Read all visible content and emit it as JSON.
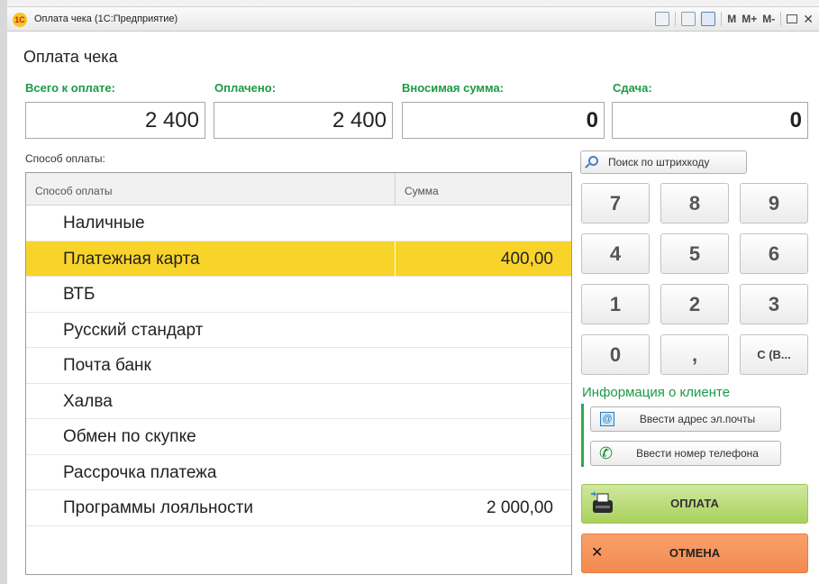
{
  "window": {
    "title": "Оплата чека  (1С:Предприятие)",
    "app_icon_text": "1С",
    "tools": [
      "print-icon",
      "calculator-icon",
      "calendar-icon",
      "M",
      "M+",
      "M-",
      "maximize-icon",
      "close-icon"
    ],
    "tool_labels": {
      "m": "M",
      "m_plus": "M+",
      "m_minus": "M-",
      "close": "✕"
    }
  },
  "page_title": "Оплата чека",
  "totals": {
    "total_label": "Всего к оплате:",
    "total_value": "2 400",
    "paid_label": "Оплачено:",
    "paid_value": "2 400",
    "deposit_label": "Вносимая сумма:",
    "deposit_value": "0",
    "change_label": "Сдача:",
    "change_value": "0"
  },
  "payment_section_label": "Способ оплаты:",
  "payment_table": {
    "columns": [
      "Способ оплаты",
      "Сумма"
    ],
    "rows": [
      {
        "method": "Наличные",
        "amount": ""
      },
      {
        "method": "Платежная карта",
        "amount": "400,00",
        "selected": true
      },
      {
        "method": "ВТБ",
        "amount": ""
      },
      {
        "method": "Русский стандарт",
        "amount": ""
      },
      {
        "method": "Почта банк",
        "amount": ""
      },
      {
        "method": "Халва",
        "amount": ""
      },
      {
        "method": "Обмен по скупке",
        "amount": ""
      },
      {
        "method": "Рассрочка платежа",
        "amount": ""
      },
      {
        "method": "Программы лояльности",
        "amount": "2 000,00"
      }
    ]
  },
  "barcode_search_label": "Поиск по штрихкоду",
  "keypad": [
    "7",
    "8",
    "9",
    "4",
    "5",
    "6",
    "1",
    "2",
    "3",
    "0",
    ",",
    "С (В..."
  ],
  "client_info": {
    "label": "Информация о клиенте",
    "email_button": "Ввести адрес эл.почты",
    "phone_button": "Ввести номер телефона"
  },
  "actions": {
    "pay": "ОПЛАТА",
    "cancel": "ОТМЕНА",
    "cancel_icon_glyph": "✕"
  },
  "colors": {
    "accent_green": "#1a9a46",
    "selected_row": "#f8d42b",
    "pay_button": "#a9d15b",
    "cancel_button": "#f28a4e"
  }
}
